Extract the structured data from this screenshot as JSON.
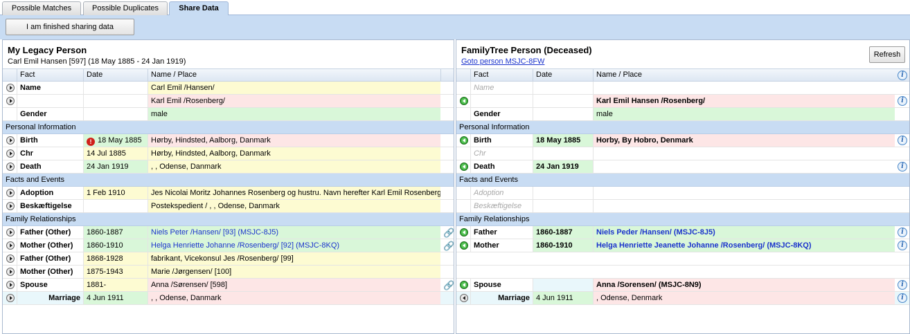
{
  "tabs": [
    "Possible Matches",
    "Possible Duplicates",
    "Share Data"
  ],
  "toolbar": {
    "finish_label": "I am finished sharing data"
  },
  "left": {
    "title": "My Legacy Person",
    "subtitle": "Carl Emil Hansen [597] (18 May 1885 - 24 Jan 1919)",
    "headers": {
      "fact": "Fact",
      "date": "Date",
      "place": "Name / Place"
    },
    "rows": {
      "name1": {
        "fact": "Name",
        "date": "",
        "place": "Carl Emil /Hansen/"
      },
      "name2": {
        "fact": "",
        "date": "",
        "place": "Karl Emil /Rosenberg/"
      },
      "gender": {
        "fact": "Gender",
        "date": "",
        "place": "male"
      },
      "sec_personal": "Personal Information",
      "birth": {
        "fact": "Birth",
        "date": "18 May 1885",
        "place": "Hørby, Hindsted, Aalborg, Danmark"
      },
      "chr": {
        "fact": "Chr",
        "date": "14 Jul 1885",
        "place": "Hørby, Hindsted, Aalborg, Danmark"
      },
      "death": {
        "fact": "Death",
        "date": "24 Jan 1919",
        "place": ", , Odense, Danmark"
      },
      "sec_facts": "Facts and Events",
      "adoption": {
        "fact": "Adoption",
        "date": "1 Feb 1910",
        "place": "Jes Nicolai Moritz Johannes Rosenberg og hustru. Navn herefter Karl Emil Rosenberg"
      },
      "besk": {
        "fact": "Beskæftigelse",
        "date": "",
        "place": "Postekspedient / , , Odense, Danmark"
      },
      "sec_family": "Family Relationships",
      "father1": {
        "fact": "Father (Other)",
        "date": "1860-1887",
        "place": "Niels Peter /Hansen/ [93] (MSJC-8J5)"
      },
      "mother1": {
        "fact": "Mother (Other)",
        "date": "1860-1910",
        "place": "Helga Henriette Johanne /Rosenberg/ [92] (MSJC-8KQ)"
      },
      "father2": {
        "fact": "Father (Other)",
        "date": "1868-1928",
        "place": "fabrikant, Vicekonsul Jes /Rosenberg/ [99]"
      },
      "mother2": {
        "fact": "Mother (Other)",
        "date": "1875-1943",
        "place": "Marie /Jørgensen/ [100]"
      },
      "spouse": {
        "fact": "Spouse",
        "date": "1881-",
        "place": "Anna /Sørensen/ [598]"
      },
      "marriage": {
        "fact": "Marriage",
        "date": "4 Jun 1911",
        "place": ", , Odense, Danmark"
      }
    }
  },
  "right": {
    "title": "FamilyTree Person (Deceased)",
    "goto": "Goto person MSJC-8FW",
    "refresh": "Refresh",
    "headers": {
      "fact": "Fact",
      "date": "Date",
      "place": "Name / Place"
    },
    "rows": {
      "name1": {
        "fact": "Name",
        "date": "",
        "place": ""
      },
      "name2": {
        "fact": "",
        "date": "",
        "place": "Karl Emil Hansen /Rosenberg/"
      },
      "gender": {
        "fact": "Gender",
        "date": "",
        "place": "male"
      },
      "sec_personal": "Personal Information",
      "birth": {
        "fact": "Birth",
        "date": "18 May 1885",
        "place": "Horby, By Hobro, Denmark"
      },
      "chr": {
        "fact": "Chr",
        "date": "",
        "place": ""
      },
      "death": {
        "fact": "Death",
        "date": "24 Jan 1919",
        "place": ""
      },
      "sec_facts": "Facts and Events",
      "adoption": {
        "fact": "Adoption",
        "date": "",
        "place": ""
      },
      "besk": {
        "fact": "Beskæftigelse",
        "date": "",
        "place": ""
      },
      "sec_family": "Family Relationships",
      "father": {
        "fact": "Father",
        "date": "1860-1887",
        "place": "Niels Peder /Hansen/ (MSJC-8J5)"
      },
      "mother": {
        "fact": "Mother",
        "date": "1860-1910",
        "place": "Helga Henriette Jeanette Johanne /Rosenberg/ (MSJC-8KQ)"
      },
      "spouse": {
        "fact": "Spouse",
        "date": "",
        "place": "Anna /Sorensen/ (MSJC-8N9)"
      },
      "marriage": {
        "fact": "Marriage",
        "date": "4 Jun 1911",
        "place": ", Odense, Denmark"
      }
    }
  },
  "icons": {
    "alert": "!",
    "info": "i",
    "link": "🔗"
  }
}
